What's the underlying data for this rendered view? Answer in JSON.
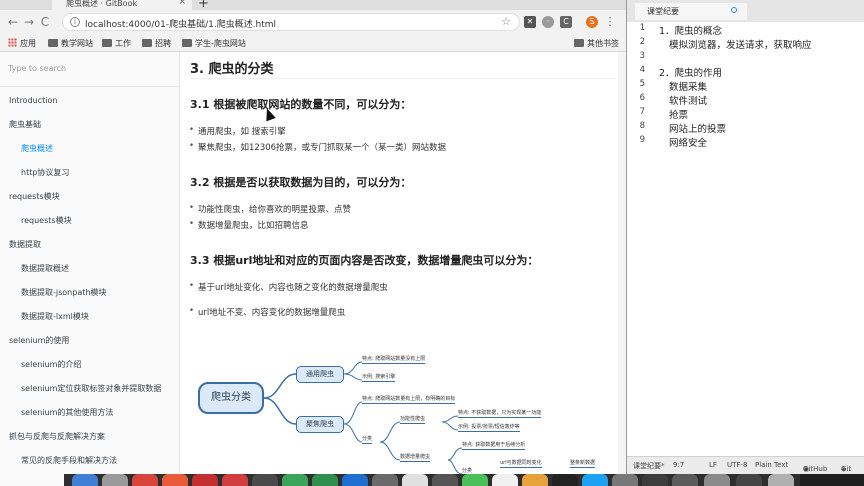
{
  "browser": {
    "tab_title": "爬虫概述 · GitBook",
    "tab_close": "×",
    "new_tab": "+",
    "nav": {
      "back": "←",
      "forward": "→",
      "reload": "C",
      "home": "⌂"
    },
    "url": "localhost:4000/01-爬虫基础/1.爬虫概述.html",
    "star": "☆",
    "profile_initial": "S",
    "bookmarks": [
      {
        "label": "应用"
      },
      {
        "label": "教学网站"
      },
      {
        "label": "工作"
      },
      {
        "label": "招聘"
      },
      {
        "label": "学生-爬虫网站"
      }
    ],
    "other_bookmarks": "其他书签"
  },
  "sidebar": {
    "search_placeholder": "Type to search",
    "items": [
      {
        "label": "Introduction",
        "level": 0,
        "active": false
      },
      {
        "label": "爬虫基础",
        "level": 0,
        "active": false
      },
      {
        "label": "爬虫概述",
        "level": 1,
        "active": true
      },
      {
        "label": "http协议复习",
        "level": 1,
        "active": false
      },
      {
        "label": "requests模块",
        "level": 0,
        "active": false
      },
      {
        "label": "requests模块",
        "level": 1,
        "active": false
      },
      {
        "label": "数据提取",
        "level": 0,
        "active": false
      },
      {
        "label": "数据提取概述",
        "level": 1,
        "active": false
      },
      {
        "label": "数据提取-jsonpath模块",
        "level": 1,
        "active": false
      },
      {
        "label": "数据提取-lxml模块",
        "level": 1,
        "active": false
      },
      {
        "label": "selenium的使用",
        "level": 0,
        "active": false
      },
      {
        "label": "selenium的介绍",
        "level": 1,
        "active": false
      },
      {
        "label": "selenium定位获取标签对象并提取数据",
        "level": 1,
        "active": false
      },
      {
        "label": "selenium的其他使用方法",
        "level": 1,
        "active": false
      },
      {
        "label": "抓包与反爬与反爬解决方案",
        "level": 0,
        "active": false
      },
      {
        "label": "常见的反爬手段和解决方法",
        "level": 1,
        "active": false
      }
    ]
  },
  "content": {
    "heading": "3. 爬虫的分类",
    "sections": [
      {
        "title": "3.1 根据被爬取网站的数量不同，可以分为：",
        "items": [
          "通用爬虫，如 搜索引擎",
          "聚焦爬虫，如12306抢票，或专门抓取某一个（某一类）网站数据"
        ]
      },
      {
        "title": "3.2 根据是否以获取数据为目的，可以分为：",
        "items": [
          "功能性爬虫，给你喜欢的明星投票、点赞",
          "数据增量爬虫，比如招聘信息"
        ]
      },
      {
        "title": "3.3 根据url地址和对应的页面内容是否改变，数据增量爬虫可以分为：",
        "items": [
          "基于url地址变化、内容也随之变化的数据增量爬虫",
          "url地址不变、内容变化的数据增量爬虫"
        ]
      }
    ],
    "mindmap": {
      "root": "爬虫分类",
      "general": "通用爬虫",
      "general_leaves": [
        "特点: 爬取网站数量没有上限",
        "示例: 搜索引擎"
      ],
      "focused": "聚焦爬虫",
      "focused_leaf": "特点: 爬取网站数量有上限，有明确的目标",
      "classify": "分类",
      "functional": "功能性爬虫",
      "functional_leaves": [
        "特点: 不获取数据，只为实现某一功能",
        "示例: 投票/抢票/短信轰炸等"
      ],
      "incremental": "数据增量爬虫",
      "incremental_leaf": "特点: 获取数据用于后续分析",
      "classify2": "分类",
      "url_change": "url与数据同时变化",
      "full_data": "整条新数据"
    }
  },
  "editor": {
    "tab_title": "课堂纪要",
    "lines": [
      {
        "num": "1",
        "text": "1．爬虫的概念"
      },
      {
        "num": "2",
        "text": "    模拟浏览器，发送请求，获取响应"
      },
      {
        "num": "3",
        "text": ""
      },
      {
        "num": "4",
        "text": "2．爬虫的作用"
      },
      {
        "num": "5",
        "text": "    数据采集"
      },
      {
        "num": "6",
        "text": "    软件测试"
      },
      {
        "num": "7",
        "text": "    抢票"
      },
      {
        "num": "8",
        "text": "    网站上的投票"
      },
      {
        "num": "9",
        "text": "    网络安全"
      }
    ],
    "status": {
      "file": "课堂纪要*",
      "cursor": "9:7",
      "line_ending": "LF",
      "encoding": "UTF-8",
      "grammar": "Plain Text",
      "github": "GitHub",
      "git": "Git"
    }
  }
}
